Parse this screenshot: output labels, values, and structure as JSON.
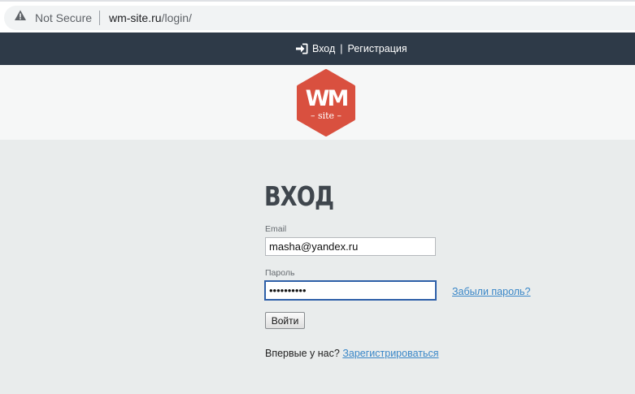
{
  "browser": {
    "security_label": "Not Secure",
    "url_domain": "wm-site.ru",
    "url_path": "/login/",
    "security_icon": "warning-triangle-icon"
  },
  "nav": {
    "login_icon": "sign-in-icon",
    "login_label": "Вход",
    "separator": "|",
    "register_label": "Регистрация"
  },
  "logo": {
    "mark": "WM",
    "sub": "– site –",
    "color": "#d9503f"
  },
  "form": {
    "heading": "ВХОД",
    "email_label": "Email",
    "email_value": "masha@yandex.ru",
    "password_label": "Пароль",
    "password_value": "••••••••••",
    "forgot_label": "Забыли пароль?",
    "submit_label": "Войти",
    "register_prompt": "Впервые у нас?",
    "register_link": "Зарегистрироваться"
  }
}
